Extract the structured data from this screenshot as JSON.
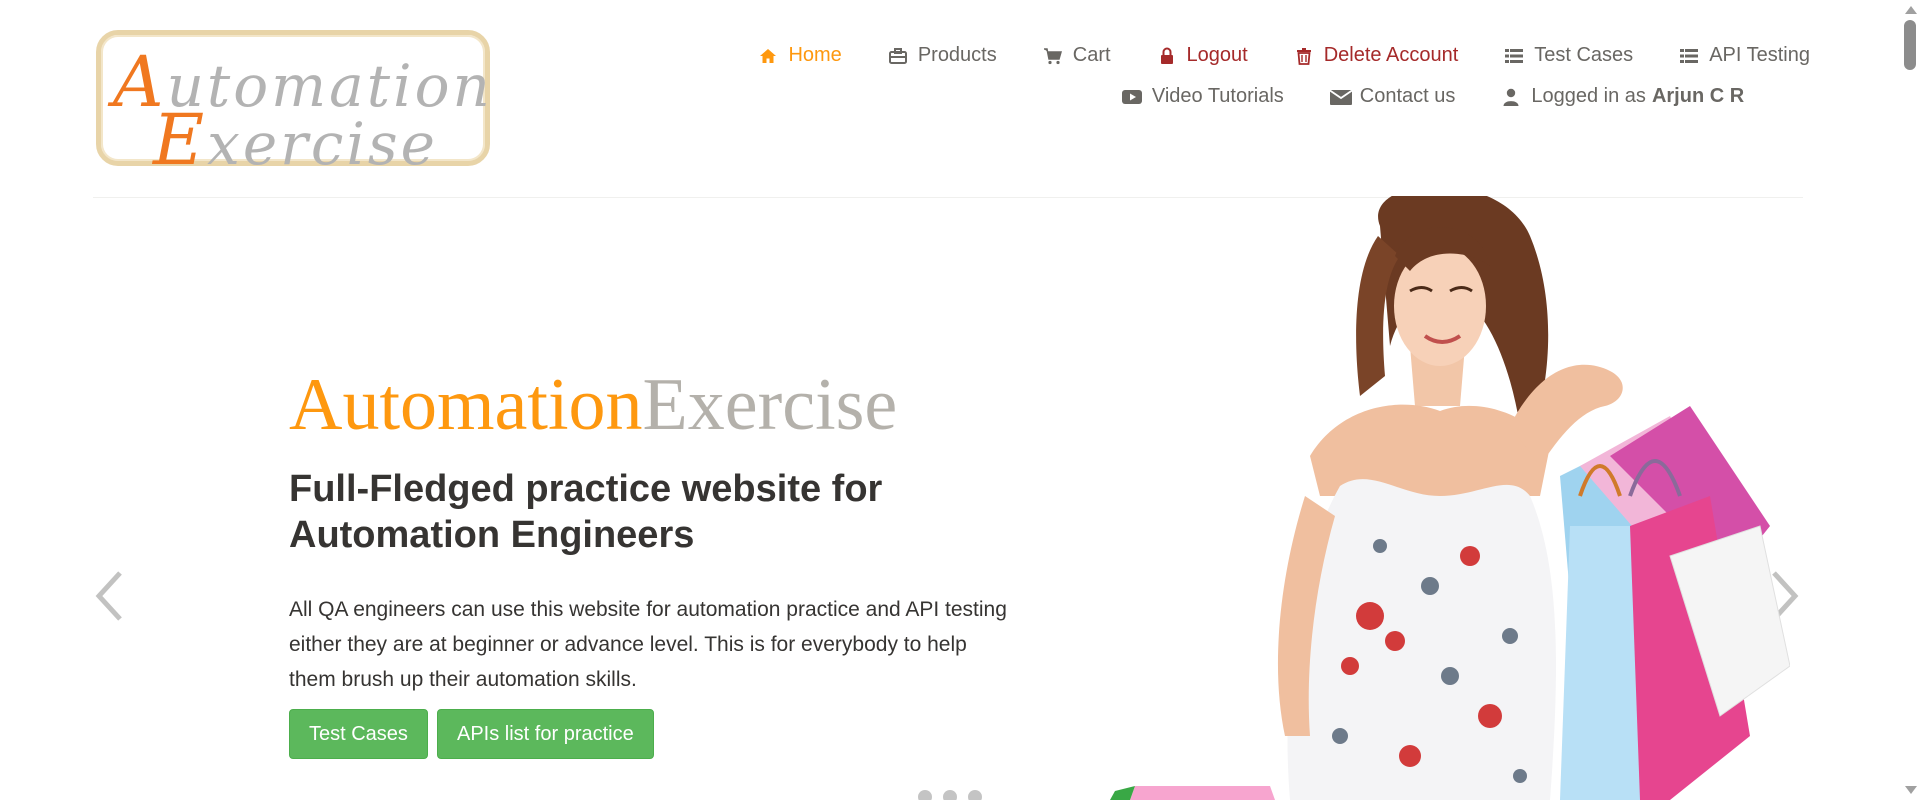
{
  "logo": {
    "line1_initial": "A",
    "line1_rest": "utomation",
    "line2_initial": "E",
    "line2_rest": "xercise"
  },
  "nav": {
    "items": [
      {
        "label": "Home",
        "icon": "home-icon",
        "active": true
      },
      {
        "label": "Products",
        "icon": "briefcase-icon"
      },
      {
        "label": "Cart",
        "icon": "cart-icon"
      },
      {
        "label": "Logout",
        "icon": "lock-icon"
      },
      {
        "label": "Delete Account",
        "icon": "trash-icon"
      },
      {
        "label": "Test Cases",
        "icon": "list-icon"
      },
      {
        "label": "API Testing",
        "icon": "list-icon"
      },
      {
        "label": "Video Tutorials",
        "icon": "youtube-play-icon"
      },
      {
        "label": "Contact us",
        "icon": "envelope-icon"
      },
      {
        "label": "Logged in as",
        "icon": "user-icon",
        "user": "Arjun C R"
      }
    ]
  },
  "hero": {
    "title_part1": "Automation",
    "title_part2": "Exercise",
    "subtitle": "Full-Fledged practice website for Automation Engineers",
    "description": "All QA engineers can use this website for automation practice and API testing either they are at beginner or advance level. This is for everybody to help them brush up their automation skills.",
    "button_test_cases": "Test Cases",
    "button_apis": "APIs list for practice"
  },
  "carousel": {
    "slide_count": 3,
    "prev_icon": "chevron-left-icon",
    "next_icon": "chevron-right-icon"
  },
  "colors": {
    "accent": "#fe980f",
    "danger": "#a52a2a",
    "nav_text": "#696763",
    "button_green": "#5cb85c",
    "title_gray": "#b4b1ab",
    "heading_dark": "#363432"
  }
}
